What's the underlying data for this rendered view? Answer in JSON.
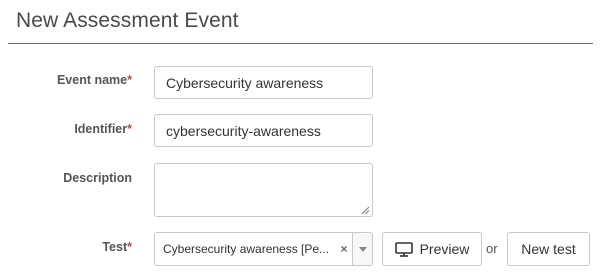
{
  "page": {
    "title": "New Assessment Event"
  },
  "form": {
    "required_marker": "*",
    "event_name": {
      "label": "Event name",
      "value": "Cybersecurity awareness"
    },
    "identifier": {
      "label": "Identifier",
      "value": "cybersecurity-awareness"
    },
    "description": {
      "label": "Description",
      "value": ""
    },
    "test": {
      "label": "Test",
      "selected": "Cybersecurity awareness [Pe...",
      "clear_symbol": "×"
    }
  },
  "actions": {
    "preview_label": "Preview",
    "or_text": "or",
    "new_test_label": "New test"
  },
  "icons": {
    "preview": "monitor-icon",
    "dropdown": "chevron-down-icon",
    "clear": "close-icon",
    "resize": "resize-grip-icon"
  },
  "colors": {
    "required": "#b94a48",
    "border": "#c8c8c8",
    "title": "#4a4a4a"
  }
}
